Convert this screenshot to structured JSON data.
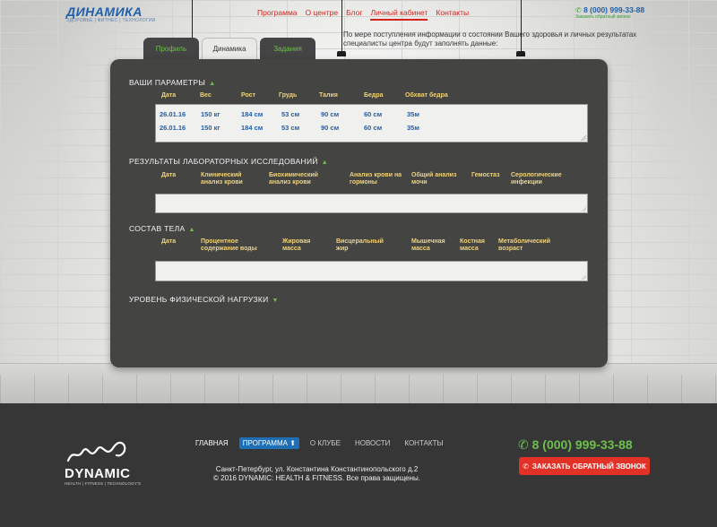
{
  "header": {
    "logo_title": "ДИНАМИКА",
    "logo_subtitle": "ЗДОРОВЬЕ | ФИТНЕС | ТЕХНОЛОГИИ",
    "nav": [
      "Программа",
      "О центре",
      "Блог",
      "Личный кабинет",
      "Контакты"
    ],
    "active_nav": "Личный кабинет",
    "phone": "8 (000) 999-33-88",
    "callback": "Заказать обратный звонок"
  },
  "intro": "По мере поступления информации о состоянии Вашего здоровья и личных результатах специалисты центра будут заполнять данные:",
  "tabs": [
    "Профиль",
    "Динамика",
    "Задания"
  ],
  "active_tab": "Динамика",
  "params": {
    "title": "ВАШИ ПАРАМЕТРЫ",
    "columns": [
      "Дата",
      "Вес",
      "Рост",
      "Грудь",
      "Талия",
      "Бедра",
      "Обхват бедра"
    ],
    "rows": [
      [
        "26.01.16",
        "150 кг",
        "184 см",
        "53 см",
        "90 см",
        "60 см",
        "35м"
      ],
      [
        "26.01.16",
        "150 кг",
        "184 см",
        "53 см",
        "90 см",
        "60 см",
        "35м"
      ]
    ]
  },
  "lab": {
    "title": "РЕЗУЛЬТАТЫ ЛАБОРАТОРНЫХ ИССЛЕДОВАНИЙ",
    "columns": [
      "Дата",
      "Клинический анализ крови",
      "Биохимический анализ крови",
      "Анализ крови на гормоны",
      "Общий анализ мочи",
      "Гемостаз",
      "Серологические инфекции"
    ]
  },
  "body": {
    "title": "СОСТАВ ТЕЛА",
    "columns": [
      "Дата",
      "Процентное содержание воды",
      "Жировая масса",
      "Висцеральный жир",
      "Мышечная масса",
      "Костная масса",
      "Метаболический возраст"
    ]
  },
  "activity": {
    "title": "УРОВЕНЬ ФИЗИЧЕСКОЙ НАГРУЗКИ"
  },
  "footer": {
    "brand": "DYNAMIC",
    "tagline": "HEALTH | FITNESS | TECHNOLOGY'S",
    "nav": [
      "ГЛАВНАЯ",
      "ПРОГРАММА",
      "О КЛУБЕ",
      "НОВОСТИ",
      "КОНТАКТЫ"
    ],
    "address": "Санкт-Петербург, ул. Константина Константинопольского д.2",
    "copyright": "© 2016 DYNAMIC: HEALTH & FITNESS. Все права защищены.",
    "phone": "8 (000) 999-33-88",
    "callback": "ЗАКАЗАТЬ ОБРАТНЫЙ ЗВОНОК"
  },
  "colors": {
    "accent_green": "#6cc04a",
    "accent_red": "#d4231c",
    "brand_blue": "#1f5fa8",
    "panel": "#444443"
  }
}
